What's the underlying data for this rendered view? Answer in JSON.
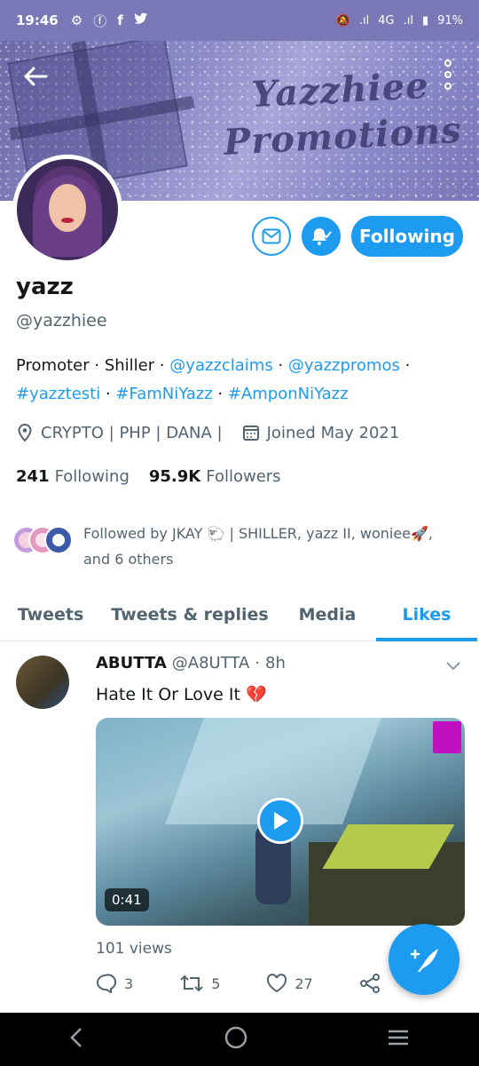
{
  "status_bar": {
    "time": "19:46",
    "network": "4G",
    "battery": "91%"
  },
  "banner": {
    "title_line1": "Yazzhiee",
    "title_line2": "Promotions"
  },
  "profile": {
    "name": "yazz",
    "handle": "@yazzhiee",
    "follow_button": "Following",
    "bio": {
      "parts": [
        "Promoter",
        "Shiller",
        "@yazzclaims",
        "@yazzpromos",
        "#yazztesti",
        "#FamNiYazz",
        "#AmponNiYazz"
      ]
    },
    "location": "CRYPTO | PHP | DANA |",
    "joined": "Joined May 2021",
    "following_count": "241",
    "following_label": "Following",
    "followers_count": "95.9K",
    "followers_label": "Followers",
    "followed_by": "Followed by JKAY 🐑 | SHILLER, yazz II, woniee🚀,",
    "followed_by_more": "and 6 others"
  },
  "tabs": [
    "Tweets",
    "Tweets & replies",
    "Media",
    "Likes"
  ],
  "active_tab": "Likes",
  "tweet": {
    "author_name": "ABUTTA",
    "author_handle": "@A8UTTA",
    "time": "8h",
    "text": "Hate It Or Love It",
    "emoji": "💔",
    "video_duration": "0:41",
    "views": "101 views",
    "replies": "3",
    "retweets": "5",
    "likes": "27"
  },
  "colors": {
    "accent": "#1d9bf0",
    "banner": "#8b88c6",
    "status_bar": "#7b78b8"
  }
}
